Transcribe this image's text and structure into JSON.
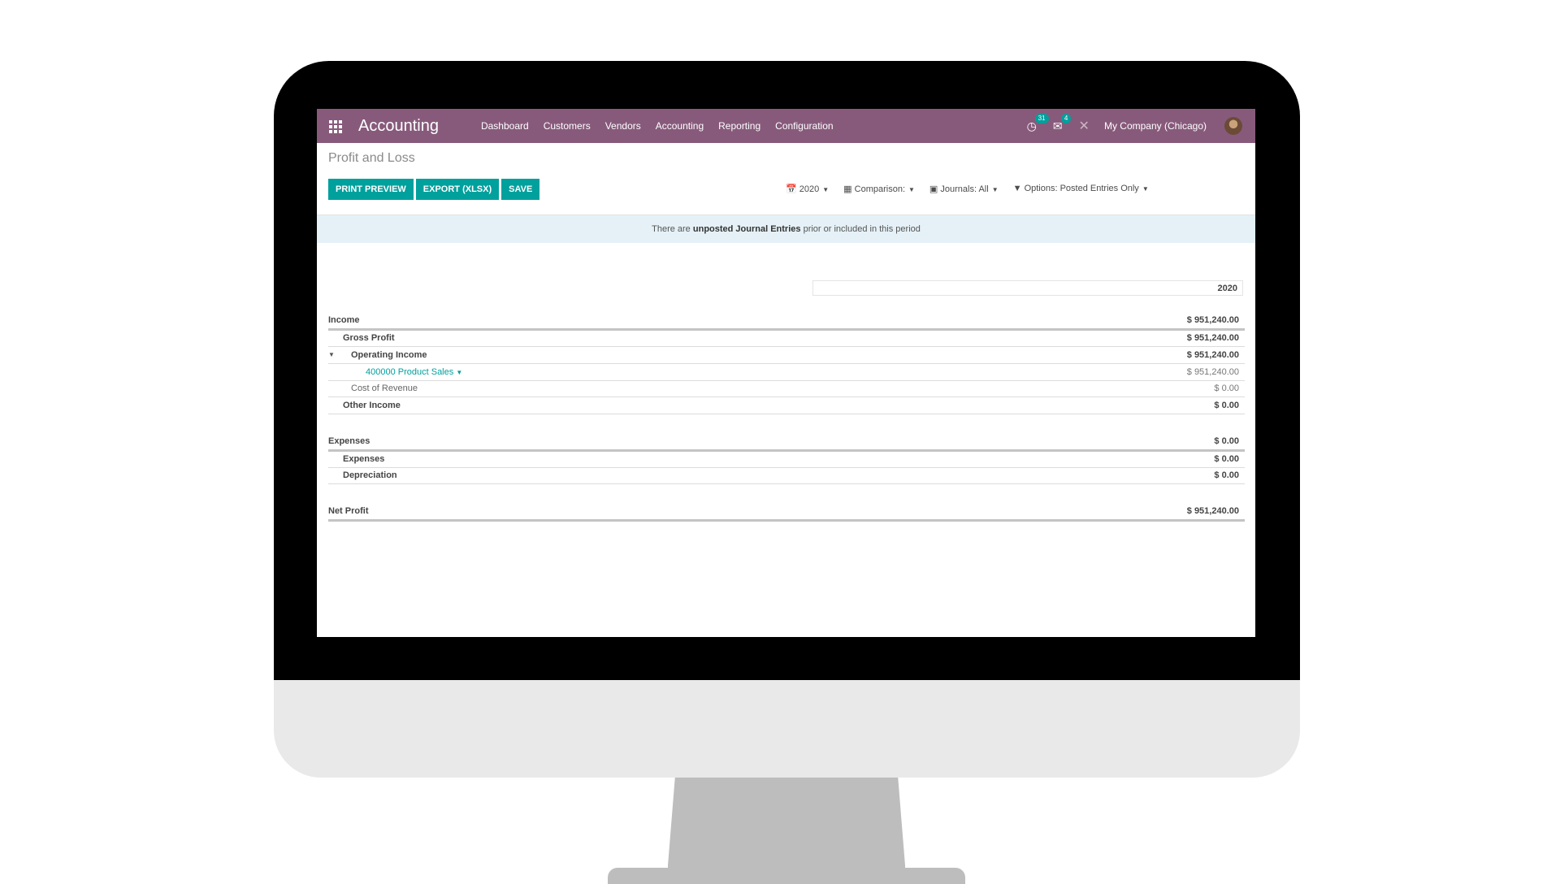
{
  "navbar": {
    "brand": "Accounting",
    "menu": [
      "Dashboard",
      "Customers",
      "Vendors",
      "Accounting",
      "Reporting",
      "Configuration"
    ],
    "activity_count": "31",
    "messages_count": "4",
    "company": "My Company (Chicago)",
    "color": "#875a7b"
  },
  "control_panel": {
    "title": "Profit and Loss",
    "buttons": {
      "print_preview": "PRINT PREVIEW",
      "export_xlsx": "EXPORT (XLSX)",
      "save": "SAVE"
    },
    "filters": {
      "period": "2020",
      "comparison": "Comparison:",
      "journals": "Journals: All",
      "options": "Options: Posted Entries Only"
    }
  },
  "alert": {
    "prefix": "There are",
    "emphasis": "unposted Journal Entries",
    "suffix": "prior or included in this period"
  },
  "report": {
    "column_header": "2020",
    "income": {
      "label": "Income",
      "value": "$ 951,240.00",
      "gross_profit": {
        "label": "Gross Profit",
        "value": "$ 951,240.00"
      },
      "operating_income": {
        "label": "Operating Income",
        "value": "$ 951,240.00"
      },
      "product_sales": {
        "label": "400000 Product Sales",
        "value": "$ 951,240.00"
      },
      "cost_of_revenue": {
        "label": "Cost of Revenue",
        "value": "$ 0.00"
      },
      "other_income": {
        "label": "Other Income",
        "value": "$ 0.00"
      }
    },
    "expenses": {
      "label": "Expenses",
      "value": "$ 0.00",
      "expenses": {
        "label": "Expenses",
        "value": "$ 0.00"
      },
      "depreciation": {
        "label": "Depreciation",
        "value": "$ 0.00"
      }
    },
    "net_profit": {
      "label": "Net Profit",
      "value": "$ 951,240.00"
    }
  },
  "accent_color": "#00a09d"
}
